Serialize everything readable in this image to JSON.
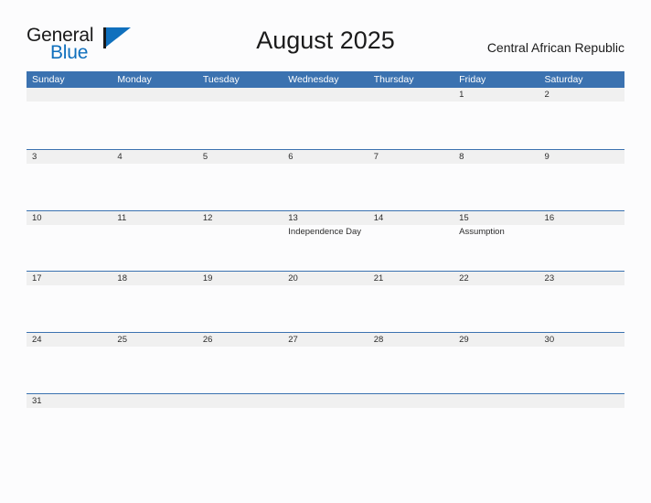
{
  "brand": {
    "name_part1": "General",
    "name_part2": "Blue",
    "mark": "triangle-logo-icon",
    "color_dark": "#1a1a1a",
    "color_blue": "#1070bd"
  },
  "header": {
    "title": "August 2025",
    "region": "Central African Republic"
  },
  "theme": {
    "header_blue": "#3b72b0",
    "band_gray": "#f0f0f0",
    "rule_blue": "#3b72b0",
    "page_bg": "#fcfcfd",
    "text": "#2b2b2b"
  },
  "weekdays": [
    "Sunday",
    "Monday",
    "Tuesday",
    "Wednesday",
    "Thursday",
    "Friday",
    "Saturday"
  ],
  "weeks": [
    {
      "days": [
        {
          "num": "",
          "events": []
        },
        {
          "num": "",
          "events": []
        },
        {
          "num": "",
          "events": []
        },
        {
          "num": "",
          "events": []
        },
        {
          "num": "",
          "events": []
        },
        {
          "num": "1",
          "events": []
        },
        {
          "num": "2",
          "events": []
        }
      ]
    },
    {
      "days": [
        {
          "num": "3",
          "events": []
        },
        {
          "num": "4",
          "events": []
        },
        {
          "num": "5",
          "events": []
        },
        {
          "num": "6",
          "events": []
        },
        {
          "num": "7",
          "events": []
        },
        {
          "num": "8",
          "events": []
        },
        {
          "num": "9",
          "events": []
        }
      ]
    },
    {
      "days": [
        {
          "num": "10",
          "events": []
        },
        {
          "num": "11",
          "events": []
        },
        {
          "num": "12",
          "events": []
        },
        {
          "num": "13",
          "events": [
            "Independence Day"
          ]
        },
        {
          "num": "14",
          "events": []
        },
        {
          "num": "15",
          "events": [
            "Assumption"
          ]
        },
        {
          "num": "16",
          "events": []
        }
      ]
    },
    {
      "days": [
        {
          "num": "17",
          "events": []
        },
        {
          "num": "18",
          "events": []
        },
        {
          "num": "19",
          "events": []
        },
        {
          "num": "20",
          "events": []
        },
        {
          "num": "21",
          "events": []
        },
        {
          "num": "22",
          "events": []
        },
        {
          "num": "23",
          "events": []
        }
      ]
    },
    {
      "days": [
        {
          "num": "24",
          "events": []
        },
        {
          "num": "25",
          "events": []
        },
        {
          "num": "26",
          "events": []
        },
        {
          "num": "27",
          "events": []
        },
        {
          "num": "28",
          "events": []
        },
        {
          "num": "29",
          "events": []
        },
        {
          "num": "30",
          "events": []
        }
      ]
    },
    {
      "days": [
        {
          "num": "31",
          "events": []
        },
        {
          "num": "",
          "events": []
        },
        {
          "num": "",
          "events": []
        },
        {
          "num": "",
          "events": []
        },
        {
          "num": "",
          "events": []
        },
        {
          "num": "",
          "events": []
        },
        {
          "num": "",
          "events": []
        }
      ]
    }
  ]
}
